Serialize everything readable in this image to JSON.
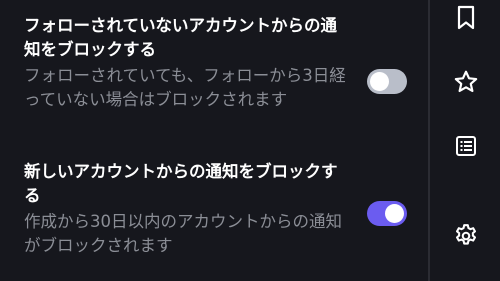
{
  "settings": [
    {
      "title": "フォローされていないアカウントからの通知をブロックする",
      "description": "フォローされていても、フォローから3日経っていない場合はブロックされます",
      "enabled": false
    },
    {
      "title": "新しいアカウントからの通知をブロックする",
      "description": "作成から30日以内のアカウントからの通知がブロックされます",
      "enabled": true
    }
  ],
  "colors": {
    "background": "#16171d",
    "toggle_on": "#6b5cf0",
    "toggle_off": "#b9bec9",
    "secondary_text": "#8b8e96"
  },
  "sidebar": {
    "icons": [
      "bookmark-icon",
      "star-icon",
      "list-icon",
      "gear-icon"
    ]
  }
}
